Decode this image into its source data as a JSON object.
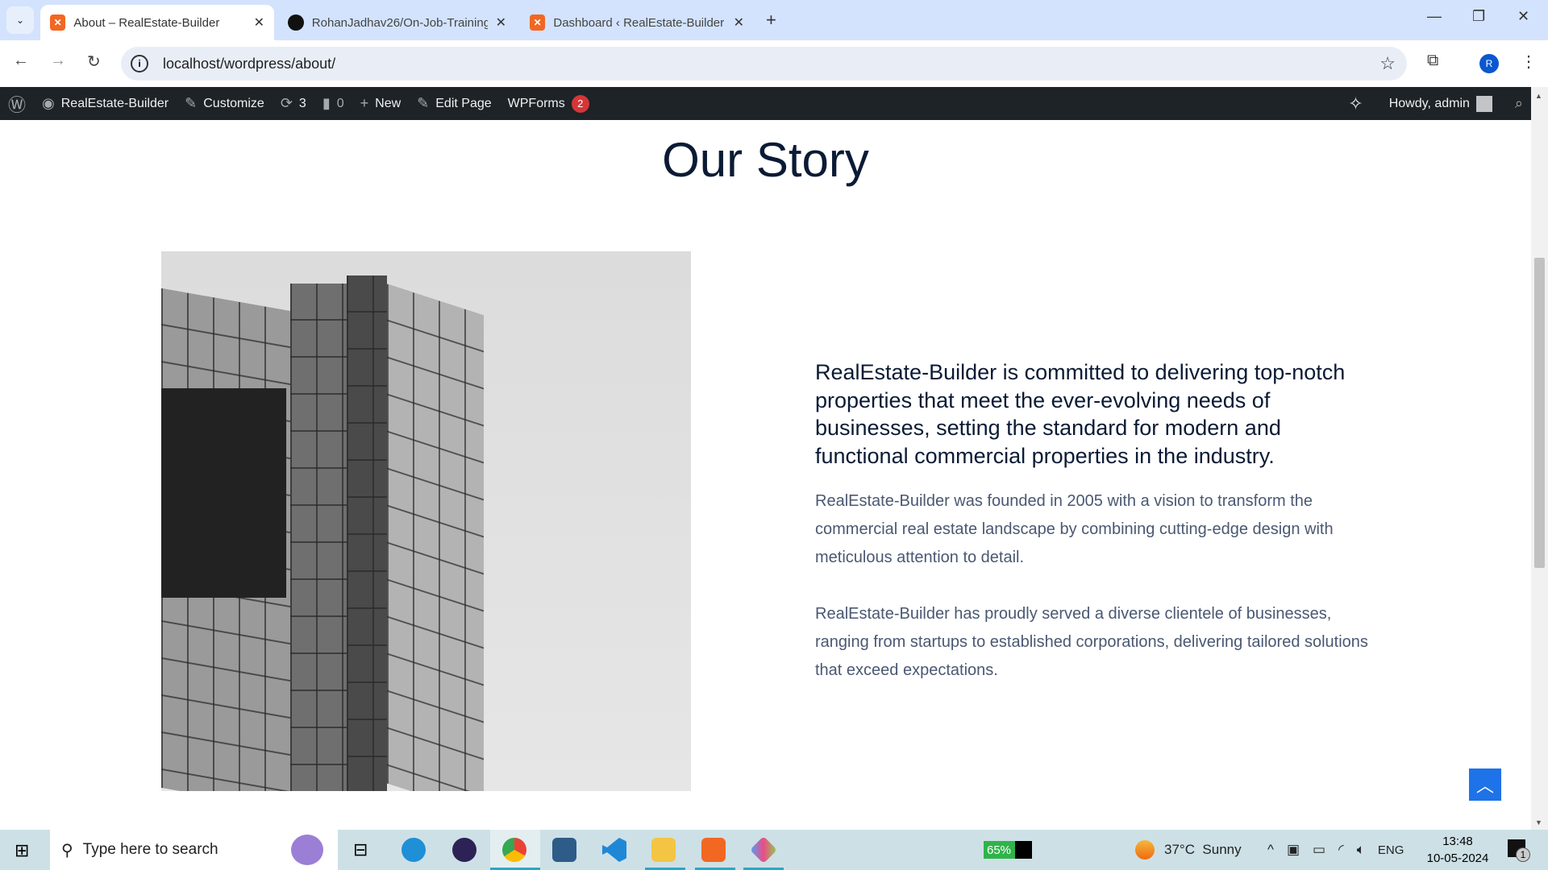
{
  "browser": {
    "tabs": [
      {
        "title": "About – RealEstate-Builder",
        "icon": "xampp-icon",
        "active": true
      },
      {
        "title": "RohanJadhav26/On-Job-Training",
        "icon": "github-icon",
        "active": false
      },
      {
        "title": "Dashboard ‹ RealEstate-Builder",
        "icon": "xampp-icon",
        "active": false
      }
    ],
    "url": "localhost/wordpress/about/",
    "profile_initial": "R"
  },
  "adminbar": {
    "site_name": "RealEstate-Builder",
    "customize": "Customize",
    "updates": "3",
    "comments": "0",
    "new": "New",
    "edit_page": "Edit Page",
    "wpforms": "WPForms",
    "wpforms_count": "2",
    "howdy": "Howdy, admin"
  },
  "page": {
    "title": "Our Story",
    "heading": "RealEstate-Builder is committed to delivering top-notch properties that meet the ever-evolving needs of businesses, setting the standard for modern and functional commercial properties in the industry.",
    "paragraph1": "RealEstate-Builder was founded in 2005 with a vision to transform the commercial real estate landscape by combining cutting-edge design with meticulous attention to detail.",
    "paragraph2": "RealEstate-Builder has proudly served a diverse clientele of businesses, ranging from startups to established corporations, delivering tailored solutions that exceed expectations.",
    "accent": "#1e73e8"
  },
  "taskbar": {
    "search_placeholder": "Type here to search",
    "battery": "65%",
    "weather": "37°C  Sunny",
    "language": "ENG",
    "time": "13:48",
    "date": "10-05-2024",
    "notifications": "1"
  }
}
